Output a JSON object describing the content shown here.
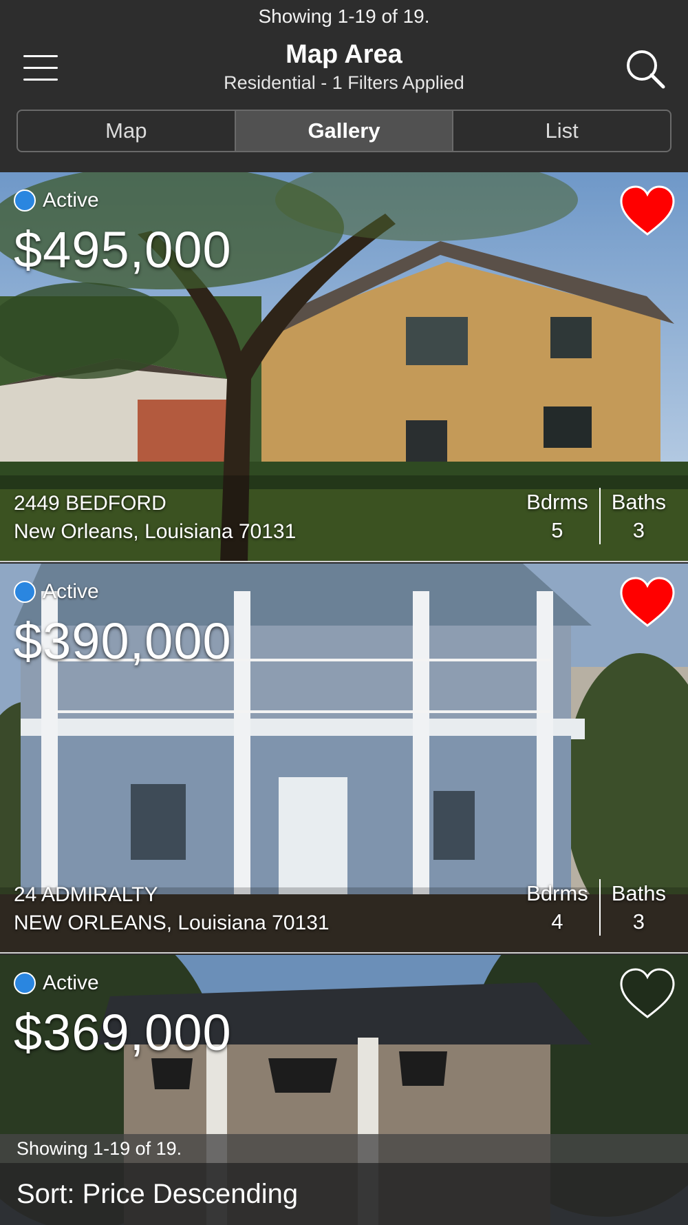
{
  "header": {
    "status": "Showing 1-19 of 19.",
    "title": "Map Area",
    "subtitle": "Residential - 1 Filters Applied",
    "tabs": [
      {
        "label": "Map",
        "active": false
      },
      {
        "label": "Gallery",
        "active": true
      },
      {
        "label": "List",
        "active": false
      }
    ]
  },
  "listings": [
    {
      "status": "Active",
      "price": "$495,000",
      "address_line1": "2449 BEDFORD",
      "address_line2": "New Orleans, Louisiana 70131",
      "bdrms_label": "Bdrms",
      "bdrms": "5",
      "baths_label": "Baths",
      "baths": "3",
      "favorited": true
    },
    {
      "status": "Active",
      "price": "$390,000",
      "address_line1": "24 ADMIRALTY",
      "address_line2": "NEW ORLEANS, Louisiana 70131",
      "bdrms_label": "Bdrms",
      "bdrms": "4",
      "baths_label": "Baths",
      "baths": "3",
      "favorited": true
    },
    {
      "status": "Active",
      "price": "$369,000",
      "favorited": false
    }
  ],
  "footer": {
    "count": "Showing 1-19 of 19.",
    "sort": "Sort: Price Descending"
  },
  "colors": {
    "status_dot": "#2a86e0",
    "heart_active": "#ff0000",
    "header_bg": "#2d2d2d"
  }
}
